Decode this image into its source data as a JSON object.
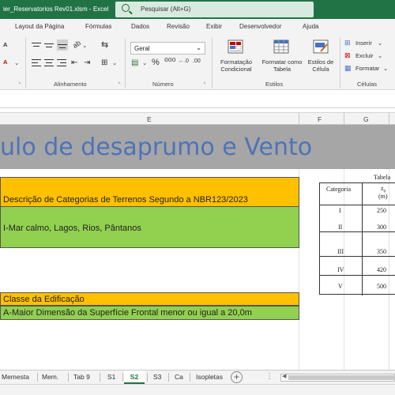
{
  "titlebar": {
    "filename": "ier_Reservatorios Rev01.xlsm  -  Excel",
    "search_placeholder": "Pesquisar (Alt+G)"
  },
  "ribbon_tabs": [
    "Layout da Página",
    "Fórmulas",
    "Dados",
    "Revisão",
    "Exibir",
    "Desenvolvedor",
    "Ajuda"
  ],
  "ribbon": {
    "groups": {
      "alignment": "Alinhamento",
      "number": "Número",
      "styles": "Estilos",
      "cells": "Células"
    },
    "number_format": "Geral",
    "buttons": {
      "conditional_formatting": "Formatação\nCondicional",
      "format_as_table": "Formatar como\nTabela",
      "cell_styles": "Estilos de\nCélula",
      "insert": "Inserir",
      "delete": "Excluir",
      "format": "Formatar"
    }
  },
  "columns": [
    "E",
    "F",
    "G"
  ],
  "sheet": {
    "banner_text": "ulo de desaprumo e Vento",
    "terrain_header": "Descrição de Categorias de Terrenos Segundo a NBR123/2023",
    "terrain_value": "I-Mar calmo, Lagos, Rios, Pântanos",
    "class_header": "Classe da Edificação",
    "class_value": "A-Maior Dimensão da Superfície Frontal menor ou igual a 20,0m"
  },
  "table": {
    "caption": "Tabela",
    "header_category": "Categoria",
    "header_z": "z",
    "header_z_sub": "0",
    "header_unit": "(m)",
    "rows": [
      {
        "cat": "I",
        "z": "250"
      },
      {
        "cat": "II",
        "z": "300"
      },
      {
        "cat": "III",
        "z": "350"
      },
      {
        "cat": "IV",
        "z": "420"
      },
      {
        "cat": "V",
        "z": "500"
      }
    ]
  },
  "sheet_tabs": [
    "Memesta",
    "Mem.",
    "Tab 9",
    "S1",
    "S2",
    "S3",
    "Ca",
    "Isopletas"
  ],
  "active_sheet": "S2",
  "colors": {
    "excel_green": "#217346",
    "banner_gray": "#a6a6a6",
    "banner_text": "#4d73b9",
    "orange": "#ffc000",
    "green": "#92d050"
  }
}
